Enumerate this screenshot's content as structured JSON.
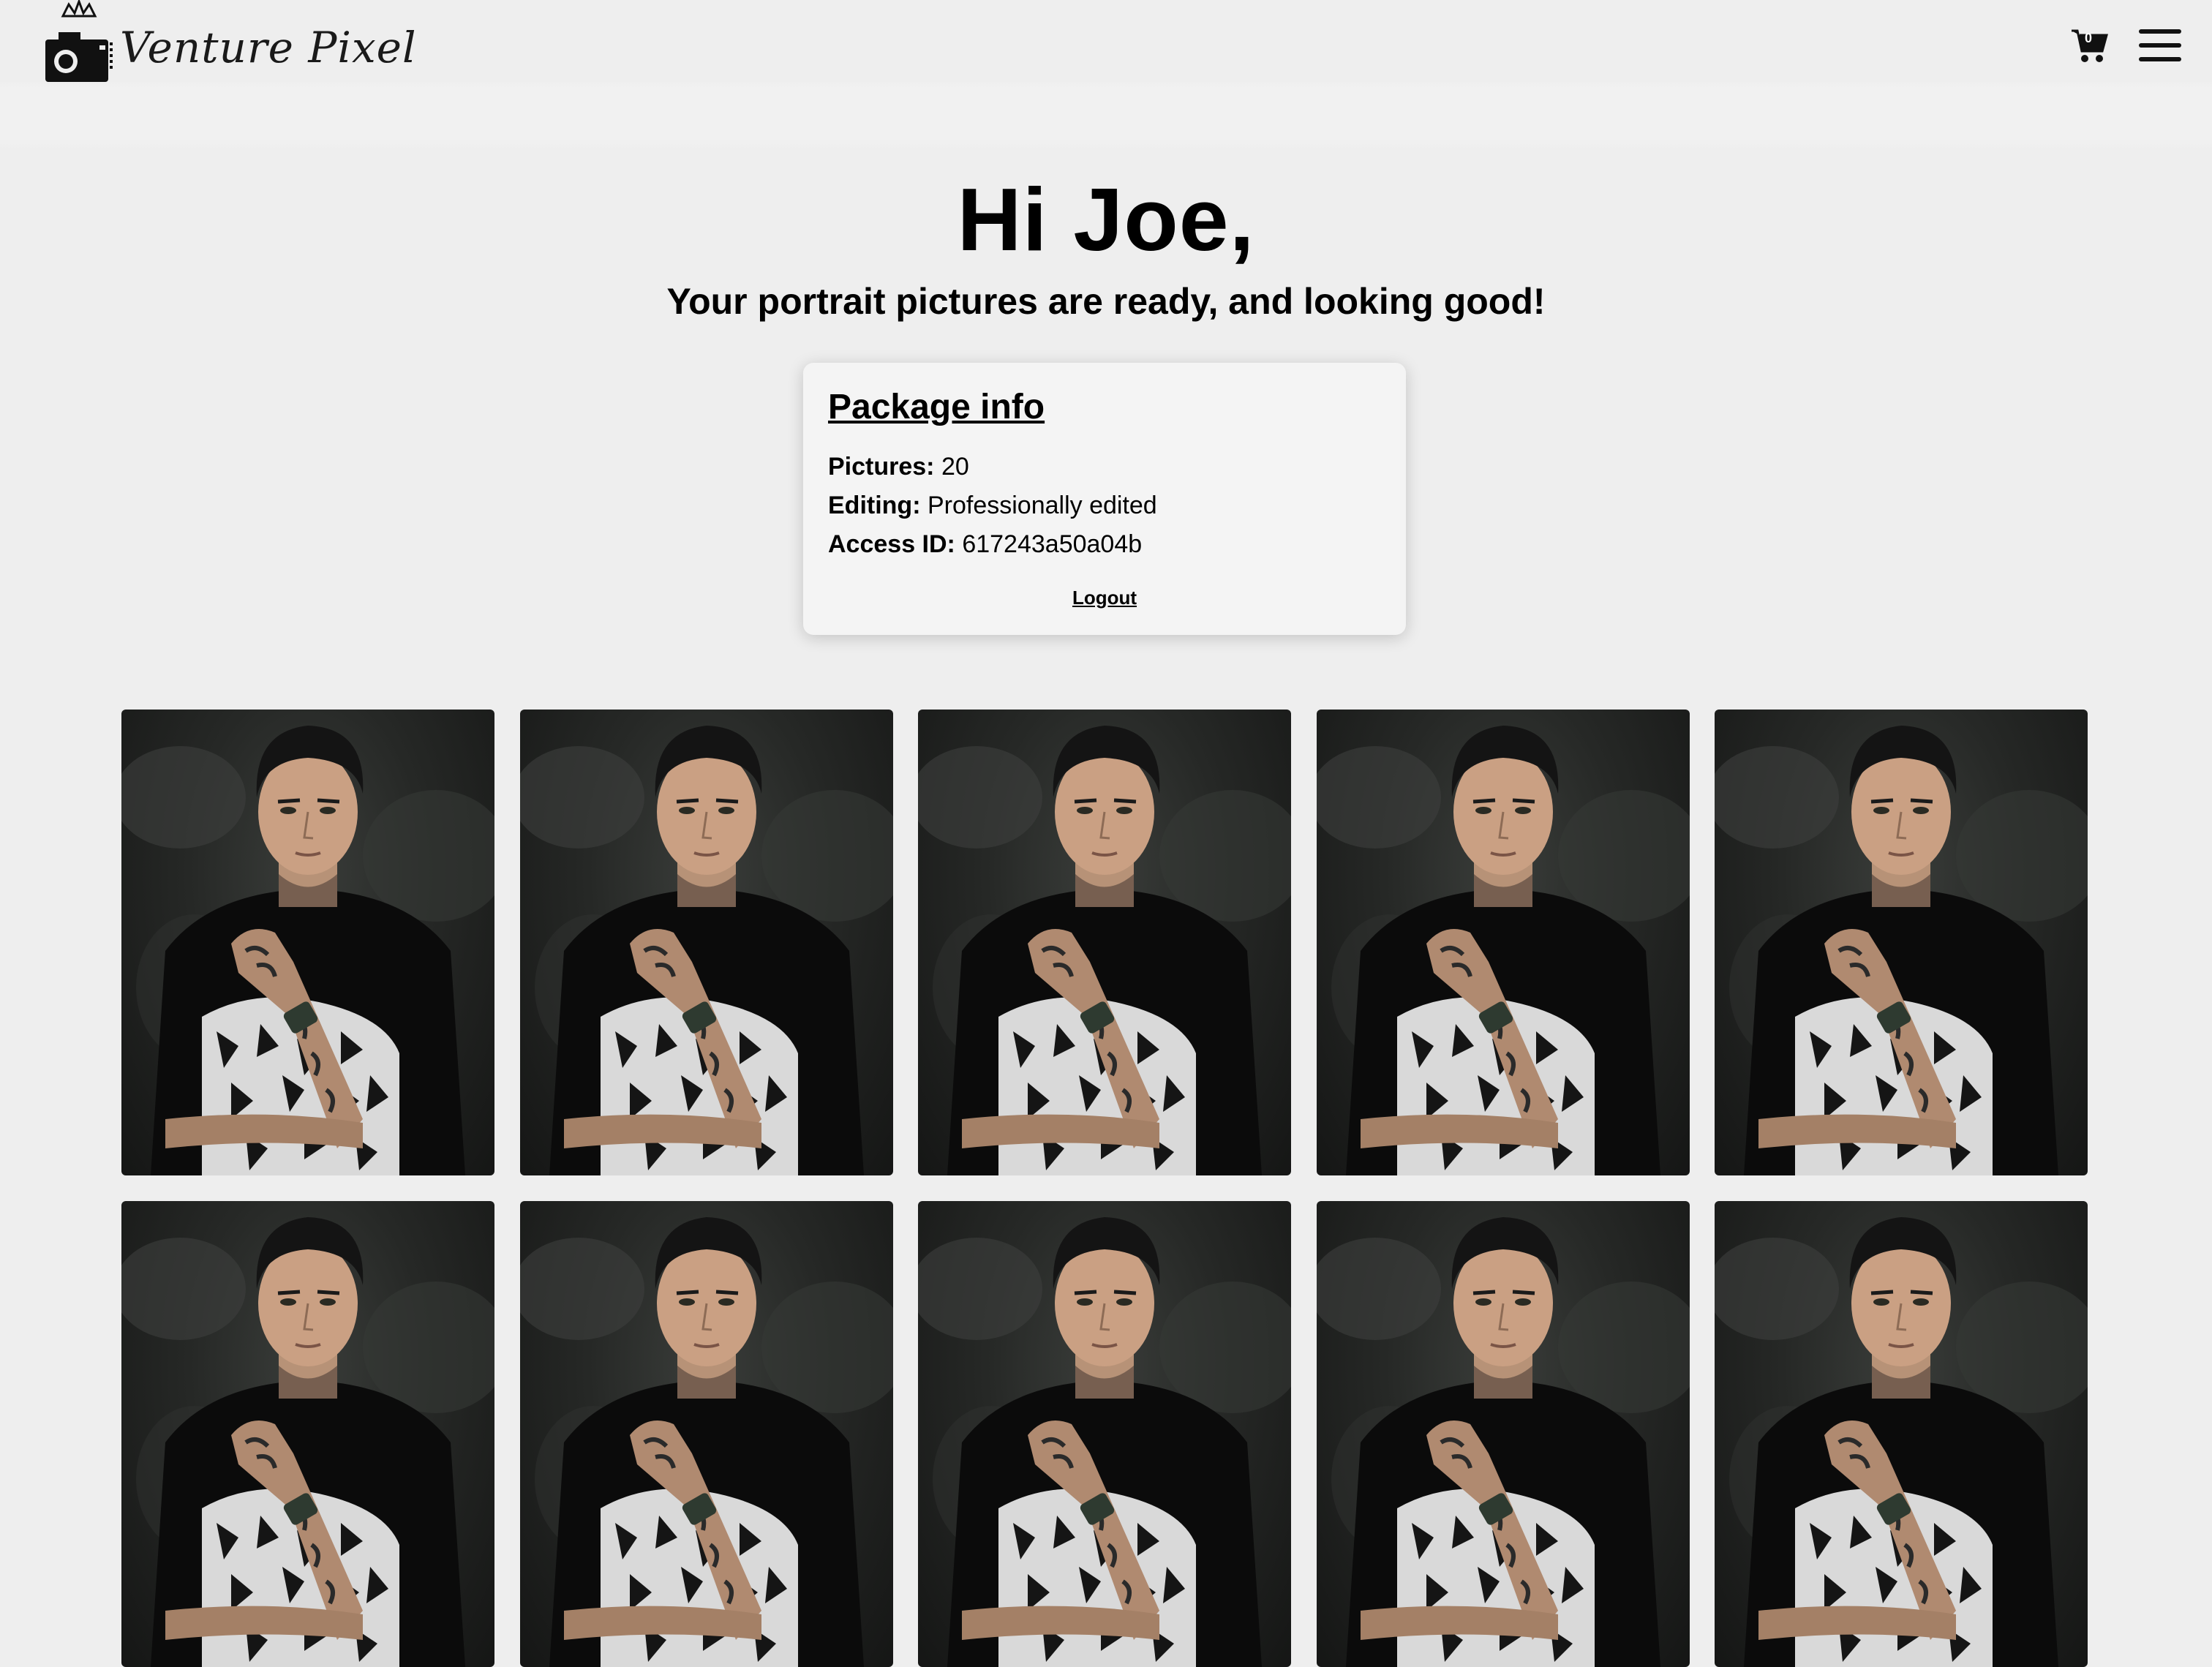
{
  "header": {
    "logo_text": "Venture Pixel",
    "logo_icon": "camera-crown-icon",
    "cart_icon": "shopping-cart-icon",
    "cart_count": "0",
    "menu_icon": "hamburger-menu-icon"
  },
  "main": {
    "greeting": "Hi Joe,",
    "subtitle": "Your portrait pictures are ready, and looking good!"
  },
  "package": {
    "title": "Package info",
    "pictures_label": "Pictures:",
    "pictures_value": "20",
    "editing_label": "Editing:",
    "editing_value": "Professionally edited",
    "access_label": "Access ID:",
    "access_value": "617243a50a04b",
    "logout_label": "Logout"
  },
  "gallery": {
    "visible_photos": 10,
    "photo_subject": "portrait-photo"
  },
  "colors": {
    "background": "#eeeeee",
    "card": "#f4f4f4",
    "text": "#000000"
  }
}
